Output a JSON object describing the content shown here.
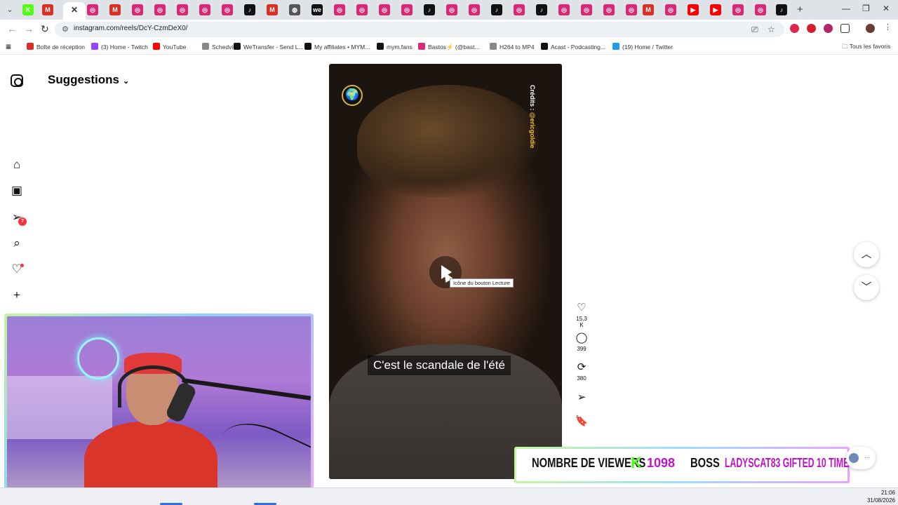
{
  "browser": {
    "url": "instagram.com/reels/DcY-CzmDeX0/",
    "tabs": [
      {
        "icon": "kick-icon",
        "color": "#53fc18",
        "glyph": "K"
      },
      {
        "icon": "gmail-icon",
        "color": "#d93025",
        "glyph": "M"
      },
      {
        "icon": "instagram-icon",
        "color": "#d62976",
        "glyph": "◎"
      },
      {
        "icon": "gmail-icon",
        "color": "#d93025",
        "glyph": "M"
      },
      {
        "icon": "instagram-icon",
        "color": "#d62976",
        "glyph": "◎"
      },
      {
        "icon": "instagram-icon",
        "color": "#d62976",
        "glyph": "◎"
      },
      {
        "icon": "instagram-icon",
        "color": "#d62976",
        "glyph": "◎"
      },
      {
        "icon": "instagram-icon",
        "color": "#d62976",
        "glyph": "◎"
      },
      {
        "icon": "instagram-icon",
        "color": "#d62976",
        "glyph": "◎"
      },
      {
        "icon": "tiktok-icon",
        "color": "#111111",
        "glyph": "♪"
      },
      {
        "icon": "gmail-icon",
        "color": "#d93025",
        "glyph": "M"
      },
      {
        "icon": "globe-icon",
        "color": "#555555",
        "glyph": "◍"
      },
      {
        "icon": "wetransfer-icon",
        "color": "#111111",
        "glyph": "we"
      },
      {
        "icon": "instagram-icon",
        "color": "#d62976",
        "glyph": "◎"
      },
      {
        "icon": "instagram-icon",
        "color": "#d62976",
        "glyph": "◎"
      },
      {
        "icon": "instagram-icon",
        "color": "#d62976",
        "glyph": "◎"
      },
      {
        "icon": "instagram-icon",
        "color": "#d62976",
        "glyph": "◎"
      },
      {
        "icon": "tiktok-icon",
        "color": "#111111",
        "glyph": "♪"
      },
      {
        "icon": "instagram-icon",
        "color": "#d62976",
        "glyph": "◎"
      },
      {
        "icon": "instagram-icon",
        "color": "#d62976",
        "glyph": "◎"
      },
      {
        "icon": "tiktok-icon",
        "color": "#111111",
        "glyph": "♪"
      },
      {
        "icon": "instagram-icon",
        "color": "#d62976",
        "glyph": "◎"
      },
      {
        "icon": "tiktok-icon",
        "color": "#111111",
        "glyph": "♪"
      },
      {
        "icon": "instagram-icon",
        "color": "#d62976",
        "glyph": "◎"
      },
      {
        "icon": "instagram-icon",
        "color": "#d62976",
        "glyph": "◎"
      },
      {
        "icon": "instagram-icon",
        "color": "#d62976",
        "glyph": "◎"
      },
      {
        "icon": "instagram-icon",
        "color": "#d62976",
        "glyph": "◎"
      },
      {
        "icon": "gmail-icon",
        "color": "#d93025",
        "glyph": "M"
      },
      {
        "icon": "instagram-icon",
        "color": "#d62976",
        "glyph": "◎"
      },
      {
        "icon": "youtube-icon",
        "color": "#ff0000",
        "glyph": "▶"
      },
      {
        "icon": "youtube-icon",
        "color": "#ff0000",
        "glyph": "▶"
      },
      {
        "icon": "instagram-icon",
        "color": "#d62976",
        "glyph": "◎"
      },
      {
        "icon": "instagram-icon",
        "color": "#d62976",
        "glyph": "◎"
      },
      {
        "icon": "tiktok-icon",
        "color": "#111111",
        "glyph": "♪"
      }
    ],
    "active_tab_glyph": "✕",
    "bookmarks": [
      {
        "label": "Boîte de réception",
        "color": "#d93025"
      },
      {
        "label": "(3) Home - Twitch",
        "color": "#9146ff"
      },
      {
        "label": "YouTube",
        "color": "#ff0000"
      },
      {
        "label": "Schedvin",
        "color": "#888888"
      },
      {
        "label": "WeTransfer - Send L...",
        "color": "#111111"
      },
      {
        "label": "My affiliates • MYM...",
        "color": "#111111"
      },
      {
        "label": "mym.fans",
        "color": "#111111"
      },
      {
        "label": "Bastos⚡ (@bast...",
        "color": "#d62976"
      },
      {
        "label": "H264 to MP4",
        "color": "#888888"
      },
      {
        "label": "Acast - Podcasting...",
        "color": "#111111"
      },
      {
        "label": "(19) Home / Twitter",
        "color": "#1d9bf0"
      }
    ],
    "favorites_label": "Tous les favoris"
  },
  "sidebar": {
    "title": "Suggestions",
    "notification_count": "7"
  },
  "reel": {
    "credit_prefix": "Crédits :",
    "credit_handle": "@ericgoldie",
    "subtitle": "C'est le scandale de l'été",
    "tooltip": "Icône du bouton Lecture"
  },
  "actions": {
    "likes": "15,3 K",
    "comments": "399",
    "reposts": "380"
  },
  "overlay": {
    "viewers_label": "NOMBRE DE VIEWERS",
    "viewers_count": "1098",
    "boss_label": "BOSS",
    "gift_text": "LADYSCAT83 GIFTED 10 TIMES",
    "messages_more": "···"
  },
  "taskbar": {
    "time": "21:06",
    "date": "31/08/2026"
  },
  "colors": {
    "accent_kick": "#53fc18",
    "banner_magenta": "#c013c8",
    "notification_red": "#ff3040"
  }
}
